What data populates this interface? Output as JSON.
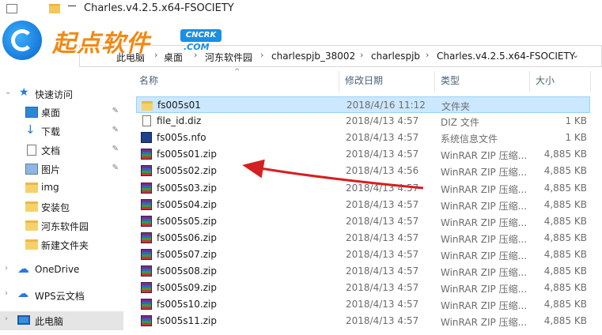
{
  "window": {
    "title": "Charles.v4.2.5.x64-FSOCIETY",
    "title_tail": ""
  },
  "watermark": {
    "logo_text": "起点软件",
    "badge": "CNCRK",
    "domain": ".COM"
  },
  "address": {
    "crumbs": [
      "此电脑",
      "桌面",
      "河东软件园",
      "charlespjb_38002",
      "charlespjb",
      "Charles.v4.2.5.x64-FSOCIETY"
    ]
  },
  "nav": {
    "quick_access": "快速访问",
    "pinned": [
      {
        "label": "桌面",
        "icon": "desktop-icon"
      },
      {
        "label": "下载",
        "icon": "download-icon"
      },
      {
        "label": "文档",
        "icon": "document-icon"
      },
      {
        "label": "图片",
        "icon": "pictures-icon"
      }
    ],
    "folders": [
      "img",
      "安装包",
      "河东软件园",
      "新建文件夹"
    ],
    "onedrive": "OneDrive",
    "wps": "WPS云文档",
    "this_pc": "此电脑"
  },
  "columns": {
    "name": "名称",
    "date": "修改日期",
    "type": "类型",
    "size": "大小"
  },
  "files": [
    {
      "name": "fs005s01",
      "date": "2018/4/16 11:12",
      "type": "文件夹",
      "size": "",
      "kind": "folder",
      "selected": true
    },
    {
      "name": "file_id.diz",
      "date": "2018/4/13 4:57",
      "type": "DIZ 文件",
      "size": "1 KB",
      "kind": "diz"
    },
    {
      "name": "fs005s.nfo",
      "date": "2018/4/13 4:57",
      "type": "系统信息文件",
      "size": "1 KB",
      "kind": "nfo"
    },
    {
      "name": "fs005s01.zip",
      "date": "2018/4/13 4:57",
      "type": "WinRAR ZIP 压缩...",
      "size": "4,885 KB",
      "kind": "rar"
    },
    {
      "name": "fs005s02.zip",
      "date": "2018/4/13 4:56",
      "type": "WinRAR ZIP 压缩...",
      "size": "4,885 KB",
      "kind": "rar"
    },
    {
      "name": "fs005s03.zip",
      "date": "2018/4/13 4:57",
      "type": "WinRAR ZIP 压缩...",
      "size": "4,885 KB",
      "kind": "rar"
    },
    {
      "name": "fs005s04.zip",
      "date": "2018/4/13 4:57",
      "type": "WinRAR ZIP 压缩...",
      "size": "4,885 KB",
      "kind": "rar"
    },
    {
      "name": "fs005s05.zip",
      "date": "2018/4/13 4:57",
      "type": "WinRAR ZIP 压缩...",
      "size": "4,885 KB",
      "kind": "rar"
    },
    {
      "name": "fs005s06.zip",
      "date": "2018/4/13 4:57",
      "type": "WinRAR ZIP 压缩...",
      "size": "4,885 KB",
      "kind": "rar"
    },
    {
      "name": "fs005s07.zip",
      "date": "2018/4/13 4:57",
      "type": "WinRAR ZIP 压缩...",
      "size": "4,885 KB",
      "kind": "rar"
    },
    {
      "name": "fs005s08.zip",
      "date": "2018/4/13 4:57",
      "type": "WinRAR ZIP 压缩...",
      "size": "4,885 KB",
      "kind": "rar"
    },
    {
      "name": "fs005s09.zip",
      "date": "2018/4/13 4:57",
      "type": "WinRAR ZIP 压缩...",
      "size": "4,885 KB",
      "kind": "rar"
    },
    {
      "name": "fs005s10.zip",
      "date": "2018/4/13 4:57",
      "type": "WinRAR ZIP 压缩...",
      "size": "4,885 KB",
      "kind": "rar"
    },
    {
      "name": "fs005s11.zip",
      "date": "2018/4/13 4:57",
      "type": "WinRAR ZIP 压缩...",
      "size": "4,885 KB",
      "kind": "rar"
    }
  ],
  "colors": {
    "selection_bg": "#cce8ff",
    "annotation_arrow": "#d42020",
    "brand_orange": "#f08a16",
    "brand_blue": "#1a8fe3"
  }
}
